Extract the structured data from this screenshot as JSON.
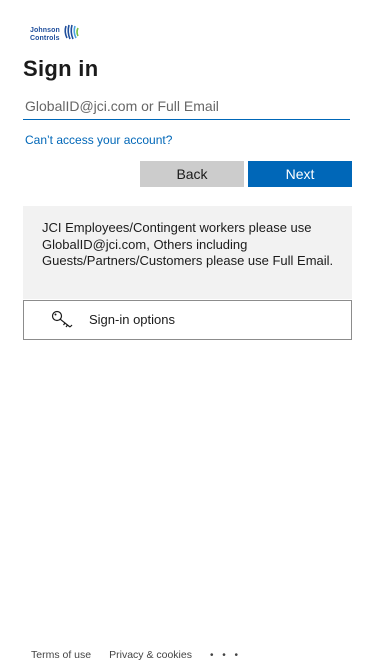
{
  "logo": {
    "line1": "Johnson",
    "line2": "Controls"
  },
  "page_title": "Sign in",
  "email": {
    "placeholder": "GlobalID@jci.com or Full Email",
    "value": ""
  },
  "cant_access_link": "Can’t access your account?",
  "buttons": {
    "back": "Back",
    "next": "Next"
  },
  "notice": "JCI Employees/Contingent workers please use GlobalID@jci.com, Others including Guests/Partners/Customers please use Full Email.",
  "signin_options": {
    "label": "Sign-in options",
    "icon": "key-icon"
  },
  "footer": {
    "terms": "Terms of use",
    "privacy": "Privacy & cookies",
    "more": "• • •"
  },
  "colors": {
    "accent": "#0067b8",
    "notice_bg": "#f2f2f2",
    "back_button": "#cccccc",
    "brand": "#1f4e9c"
  }
}
